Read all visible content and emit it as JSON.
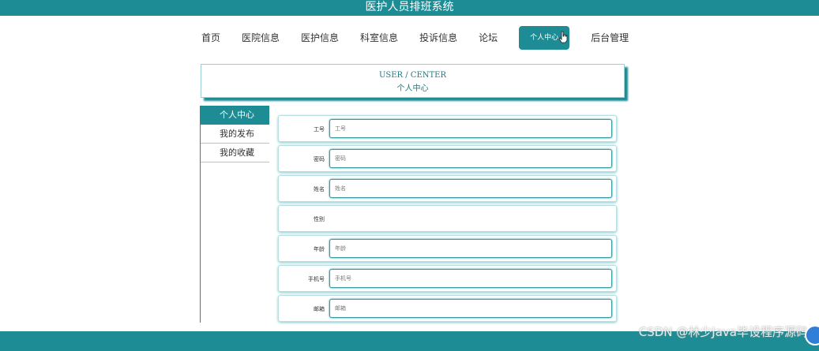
{
  "site": {
    "title": "医护人员排班系统"
  },
  "nav": {
    "items": [
      {
        "label": "首页"
      },
      {
        "label": "医院信息"
      },
      {
        "label": "医护信息"
      },
      {
        "label": "科室信息"
      },
      {
        "label": "投诉信息"
      },
      {
        "label": "论坛"
      },
      {
        "label": "个人中心"
      },
      {
        "label": "后台管理"
      }
    ]
  },
  "banner": {
    "en": "USER / CENTER",
    "cn": "个人中心"
  },
  "sidebar": {
    "items": [
      {
        "label": "个人中心"
      },
      {
        "label": "我的发布"
      },
      {
        "label": "我的收藏"
      }
    ]
  },
  "form": {
    "fields": [
      {
        "label": "工号",
        "placeholder": "工号"
      },
      {
        "label": "密码",
        "placeholder": "密码"
      },
      {
        "label": "姓名",
        "placeholder": "姓名"
      },
      {
        "label": "性别"
      },
      {
        "label": "年龄",
        "placeholder": "年龄"
      },
      {
        "label": "手机号",
        "placeholder": "手机号"
      },
      {
        "label": "邮箱",
        "placeholder": "邮箱"
      }
    ]
  },
  "watermark": "CSDN @林少Java毕设程序源码",
  "colors": {
    "primary": "#1e8c94",
    "border": "#9bcfd3"
  }
}
